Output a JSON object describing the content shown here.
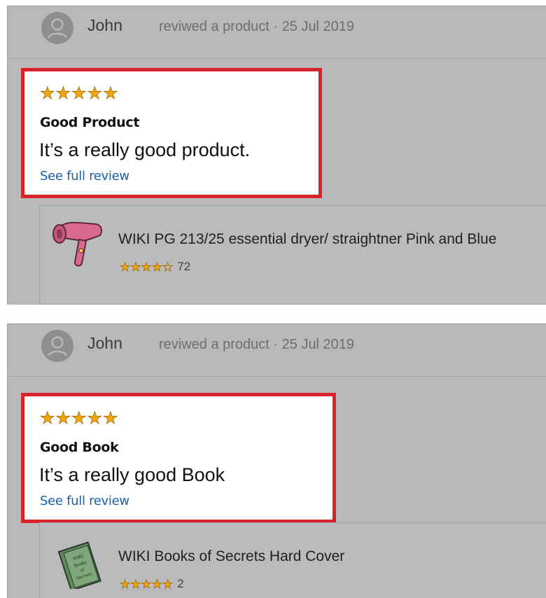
{
  "reviews": [
    {
      "user": {
        "name": "John",
        "meta": "reviwed a product · 25 Jul 2019"
      },
      "rating": 5,
      "title": "Good Product",
      "body": "It’s a really good product.",
      "link": "See full review",
      "product": {
        "name": "WIKI PG 213/25 essential dryer/ straightner Pink and Blue",
        "rating": 3.5,
        "rating_count": "72",
        "icon": "hair-dryer-icon"
      }
    },
    {
      "user": {
        "name": "John",
        "meta": "reviwed a product · 25 Jul 2019"
      },
      "rating": 5,
      "title": "Good Book",
      "body": "It’s a really good Book",
      "link": "See full review",
      "product": {
        "name": "WIKI Books of Secrets Hard Cover",
        "rating": 5,
        "rating_count": "2",
        "icon": "book-icon",
        "cover_text": "WIKI Books of Secrets"
      }
    }
  ],
  "colors": {
    "highlight": "#d8232a",
    "star": "#f0a70e",
    "link": "#1a5fa8",
    "background": "#b9b9bb"
  }
}
